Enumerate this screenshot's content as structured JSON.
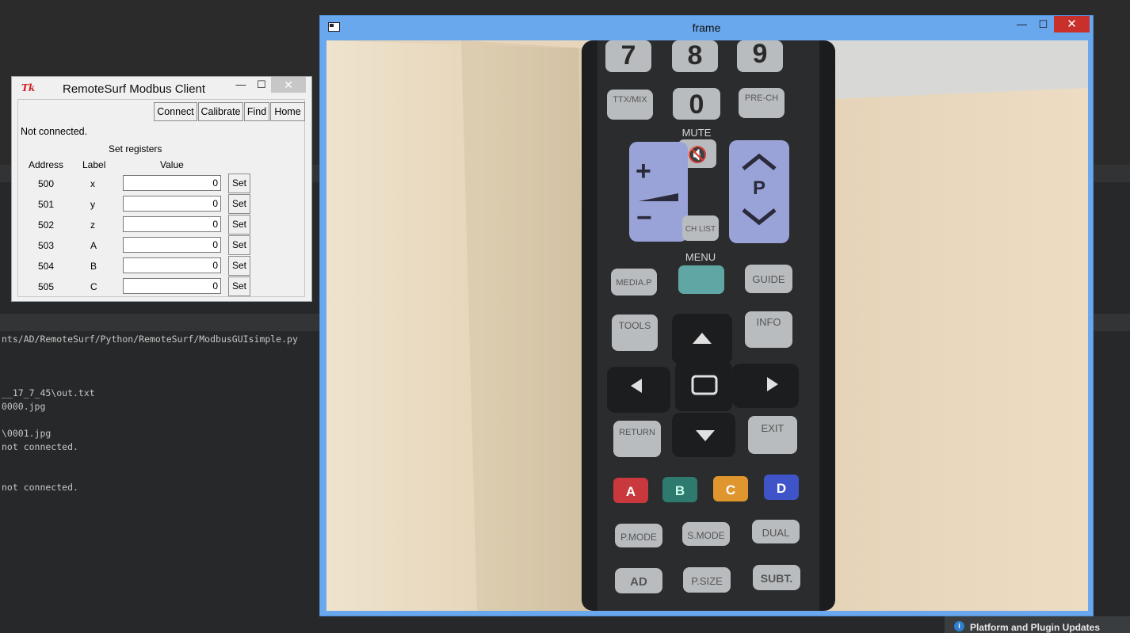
{
  "ide": {
    "lines": [
      "nts/AD/RemoteSurf/Python/RemoteSurf/ModbusGUIsimple.py",
      "__17_7_45\\out.txt",
      "0000.jpg",
      "\\0001.jpg",
      "not connected.",
      "not connected."
    ],
    "status_text": "Platform and Plugin Updates"
  },
  "tk_window": {
    "title": "RemoteSurf Modbus Client",
    "logo": "Tk",
    "minimize": "—",
    "maximize": "☐",
    "close": "✕",
    "buttons": {
      "connect": "Connect",
      "calibrate": "Calibrate",
      "find": "Find",
      "home": "Home"
    },
    "status": "Not connected.",
    "section": "Set registers",
    "headers": {
      "address": "Address",
      "label": "Label",
      "value": "Value"
    },
    "set_label": "Set",
    "rows": [
      {
        "address": "500",
        "label": "x",
        "value": "0"
      },
      {
        "address": "501",
        "label": "y",
        "value": "0"
      },
      {
        "address": "502",
        "label": "z",
        "value": "0"
      },
      {
        "address": "503",
        "label": "A",
        "value": "0"
      },
      {
        "address": "504",
        "label": "B",
        "value": "0"
      },
      {
        "address": "505",
        "label": "C",
        "value": "0"
      }
    ]
  },
  "frame_window": {
    "title": "frame",
    "minimize": "—",
    "maximize": "☐",
    "close": "✕"
  },
  "remote": {
    "keys_top": [
      "7",
      "8",
      "9"
    ],
    "ttx_mix": "TTX/MIX",
    "zero": "0",
    "pre_ch": "PRE-CH",
    "mute": "MUTE",
    "plus": "+",
    "minus": "−",
    "p": "P",
    "ch_list": "CH LIST",
    "menu": "MENU",
    "media_p": "MEDIA.P",
    "guide": "GUIDE",
    "tools": "TOOLS",
    "info": "INFO",
    "return": "RETURN",
    "exit": "EXIT",
    "color_keys": [
      "A",
      "B",
      "C",
      "D"
    ],
    "p_mode": "P.MODE",
    "s_mode": "S.MODE",
    "dual": "DUAL",
    "ad": "AD",
    "p_size": "P.SIZE",
    "subt": "SUBT.",
    "colors": {
      "key_red": "#c8383c",
      "key_green": "#2f7a6e",
      "key_orange": "#e0962e",
      "key_blue": "#3e54c8",
      "vol_ch_pad": "#9aa3d8",
      "remote_body": "#2a2b2d",
      "wood": "#eadcc6"
    }
  }
}
